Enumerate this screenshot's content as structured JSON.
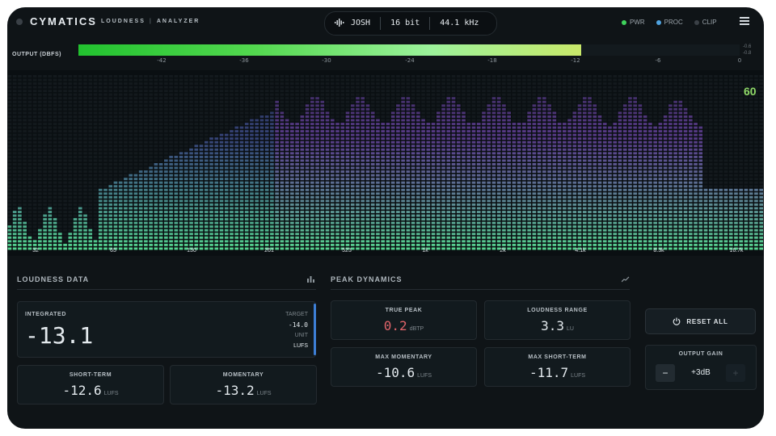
{
  "app": {
    "brand": "CYMATICS",
    "subtitle_a": "LOUDNESS",
    "subtitle_sep": "|",
    "subtitle_b": "ANALYZER"
  },
  "status": {
    "preset": "JOSH",
    "bit_depth": "16 bit",
    "sample_rate": "44.1 kHz"
  },
  "indicators": [
    {
      "label": "PWR",
      "color": "#3fd35c"
    },
    {
      "label": "PROC",
      "color": "#4fa3e0"
    },
    {
      "label": "CLIP",
      "color": "#3a4046"
    }
  ],
  "output": {
    "label": "OUTPUT (DBFS)",
    "level_fraction": 0.76,
    "ticks": [
      "-42",
      "-36",
      "-30",
      "-24",
      "-18",
      "-12",
      "-6",
      "0"
    ],
    "peak_left": "-0.6",
    "peak_right": "-0.8"
  },
  "spectrum": {
    "readout": "60",
    "frequencies": [
      "32",
      "65",
      "130",
      "261",
      "523",
      "1k",
      "2k",
      "4.1k",
      "8.3k",
      "16.7k"
    ]
  },
  "loudness": {
    "title": "LOUDNESS DATA",
    "integrated_label": "INTEGRATED",
    "integrated_value": "-13.1",
    "target_label": "TARGET",
    "target_value": "-14.0",
    "unit_label": "UNIT",
    "unit_value": "LUFS",
    "short_term_label": "SHORT-TERM",
    "short_term_value": "-12.6",
    "momentary_label": "MOMENTARY",
    "momentary_value": "-13.2",
    "lufs": "LUFS"
  },
  "peak": {
    "title": "PEAK DYNAMICS",
    "true_peak_label": "TRUE PEAK",
    "true_peak_value": "0.2",
    "true_peak_unit": "dBTP",
    "true_peak_color": "#e0646a",
    "range_label": "LOUDNESS RANGE",
    "range_value": "3.3",
    "range_unit": "LU",
    "max_momentary_label": "MAX MOMENTARY",
    "max_momentary_value": "-10.6",
    "max_short_label": "MAX SHORT-TERM",
    "max_short_value": "-11.7",
    "lufs": "LUFS"
  },
  "controls": {
    "reset_label": "RESET ALL",
    "gain_label": "OUTPUT GAIN",
    "gain_value": "+3dB",
    "minus": "−",
    "plus": "+"
  }
}
